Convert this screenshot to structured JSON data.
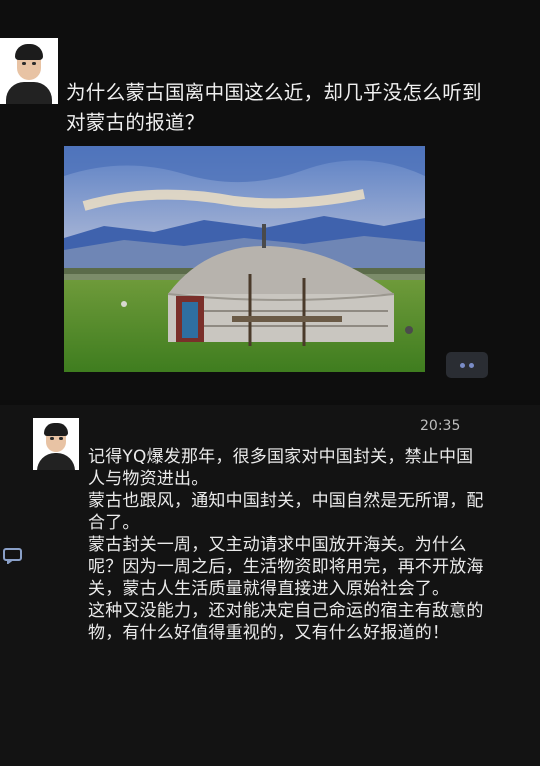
{
  "post1": {
    "question_text": "为什么蒙古国离中国这么近，却几乎没怎么听到对蒙古的报道？",
    "photo_icon": "yurt-landscape-image",
    "more_icon": "more-dots-icon",
    "colors": {
      "accent": "#7a8cc6",
      "background": "#0e0e0e"
    }
  },
  "post2": {
    "time": "20:35",
    "paragraphs": [
      "记得YQ爆发那年，很多国家对中国封关，禁止中国人与物资进出。",
      "蒙古也跟风，通知中国封关，中国自然是无所谓，配合了。",
      "蒙古封关一周，又主动请求中国放开海关。为什么呢？因为一周之后，生活物资即将用完，再不开放海关，蒙古人生活质量就得直接进入原始社会了。",
      "这种又没能力，还对能决定自己命运的宿主有敌意的物，有什么好值得重视的，又有什么好报道的！"
    ],
    "comment_icon": "comment-icon"
  }
}
